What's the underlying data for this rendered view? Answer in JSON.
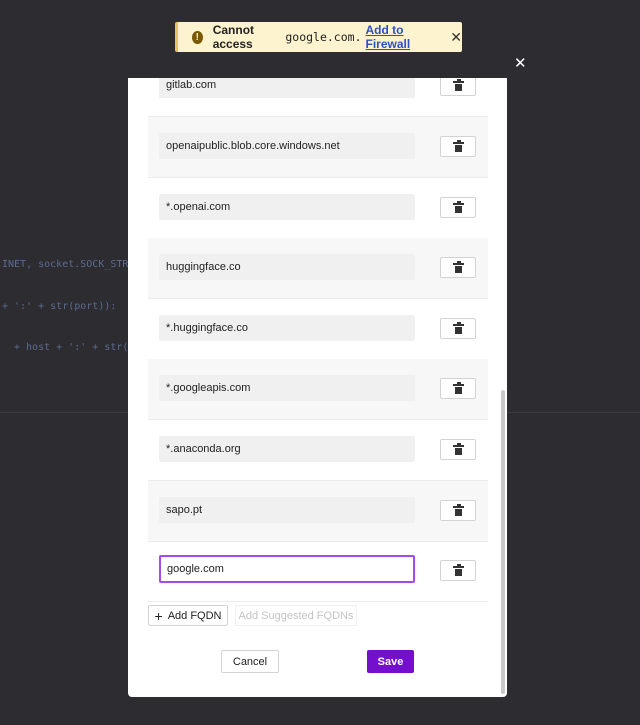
{
  "background": {
    "code_lines": [
      "INET, socket.SOCK_STR",
      "+ ':' + str(port)):",
      "+ host + ':' + str("
    ]
  },
  "toast": {
    "message": "Cannot access",
    "domain": "google.com.",
    "link": "Add to Firewall",
    "close": "✕",
    "icon": "!",
    "bg_color": "#fdf3cf"
  },
  "modal": {
    "close": "✕",
    "entries": [
      {
        "value": "gitlab.com"
      },
      {
        "value": "openaipublic.blob.core.windows.net"
      },
      {
        "value": "*.openai.com"
      },
      {
        "value": "huggingface.co"
      },
      {
        "value": "*.huggingface.co"
      },
      {
        "value": "*.googleapis.com"
      },
      {
        "value": "*.anaconda.org"
      },
      {
        "value": "sapo.pt"
      },
      {
        "value": "google.com"
      }
    ],
    "add_fqdn_label": "Add FQDN",
    "add_suggested_label": "Add Suggested FQDNs",
    "cancel_label": "Cancel",
    "save_label": "Save",
    "accent_color": "#7410cc",
    "focus_color": "#a54be8"
  }
}
